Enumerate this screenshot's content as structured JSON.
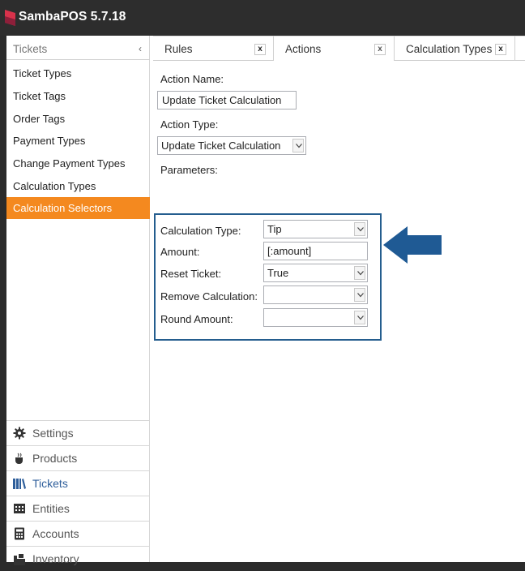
{
  "app": {
    "title_prefix": "Samba",
    "title_suffix": "POS 5.7.18"
  },
  "sidebar": {
    "header": "Tickets",
    "collapse_glyph": "‹",
    "items": [
      {
        "label": "Ticket Types"
      },
      {
        "label": "Ticket Tags"
      },
      {
        "label": "Order Tags"
      },
      {
        "label": "Payment Types"
      },
      {
        "label": "Change Payment Types"
      },
      {
        "label": "Calculation Types"
      },
      {
        "label": "Calculation Selectors",
        "active": true
      }
    ],
    "nav": [
      {
        "label": "Settings",
        "icon": "gear-icon"
      },
      {
        "label": "Products",
        "icon": "coffee-cup-icon"
      },
      {
        "label": "Tickets",
        "icon": "tickets-books-icon",
        "current": true
      },
      {
        "label": "Entities",
        "icon": "entities-grid-icon"
      },
      {
        "label": "Accounts",
        "icon": "calculator-icon"
      },
      {
        "label": "Inventory",
        "icon": "inventory-icon"
      }
    ]
  },
  "tabs": [
    {
      "label": "Rules",
      "close": "x"
    },
    {
      "label": "Actions",
      "close": "x"
    },
    {
      "label": "Calculation Types",
      "close": "x"
    }
  ],
  "form": {
    "action_name_label": "Action Name:",
    "action_name_value": "Update Ticket Calculation",
    "action_type_label": "Action Type:",
    "action_type_value": "Update Ticket Calculation",
    "parameters_label": "Parameters:",
    "params": {
      "calculation_type_label": "Calculation Type:",
      "calculation_type_value": "Tip",
      "amount_label": "Amount:",
      "amount_value": "[:amount]",
      "reset_ticket_label": "Reset Ticket:",
      "reset_ticket_value": "True",
      "remove_calculation_label": "Remove Calculation:",
      "remove_calculation_value": "",
      "round_amount_label": "Round Amount:",
      "round_amount_value": ""
    }
  },
  "colors": {
    "accent_orange": "#f4891f",
    "highlight_blue": "#245d8e",
    "titlebar": "#2d2d2d"
  }
}
